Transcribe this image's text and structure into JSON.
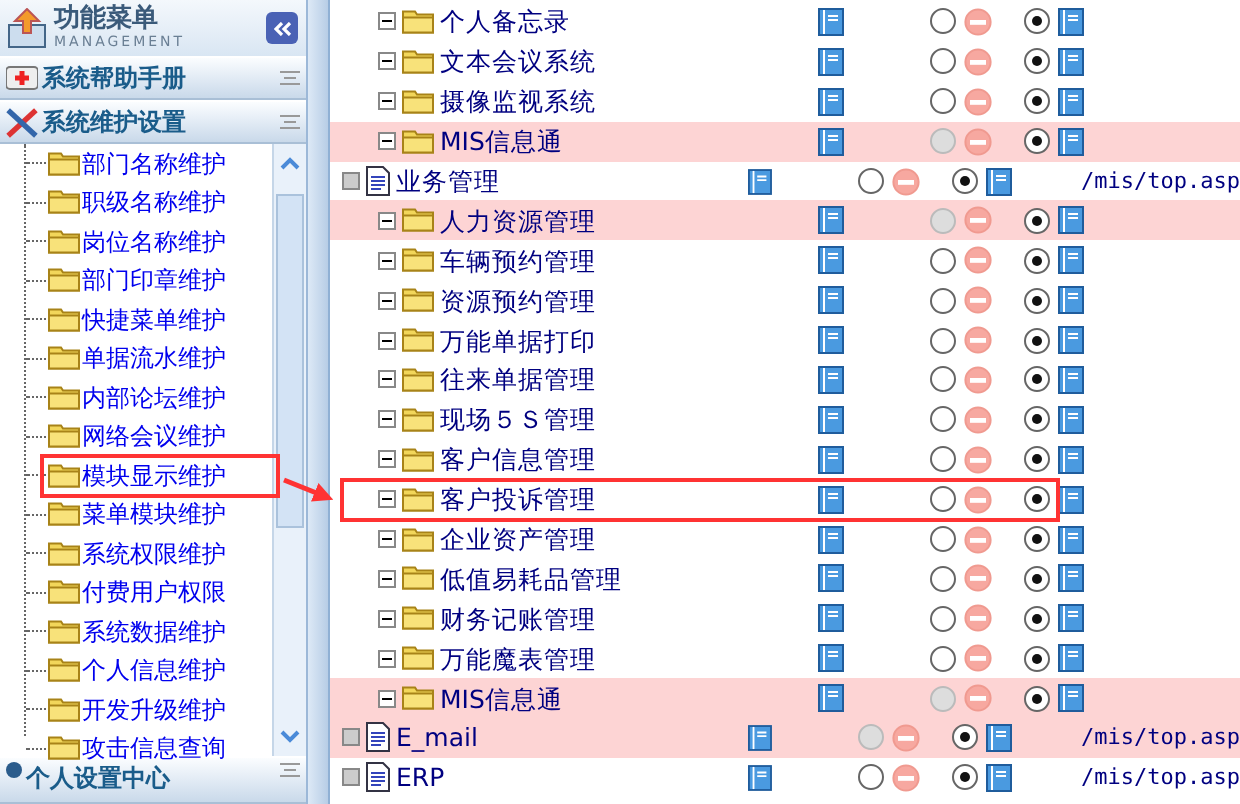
{
  "sidebar": {
    "title": "功能菜单",
    "subtitle": "MANAGEMENT",
    "sections": [
      {
        "label": "系统帮助手册",
        "kind": "help"
      },
      {
        "label": "系统维护设置",
        "kind": "tools"
      }
    ],
    "items": [
      "部门名称维护",
      "职级名称维护",
      "岗位名称维护",
      "部门印章维护",
      "快捷菜单维护",
      "单据流水维护",
      "内部论坛维护",
      "网络会议维护",
      "模块显示维护",
      "菜单模块维护",
      "系统权限维护",
      "付费用户权限",
      "系统数据维护",
      "个人信息维护",
      "开发升级维护",
      "攻击信息查询"
    ],
    "footer_section": {
      "label": "个人设置中心"
    }
  },
  "rows": [
    {
      "label": "个人备忘录",
      "kind": "folder",
      "highlighted": false,
      "disabled": false,
      "shown": true
    },
    {
      "label": "文本会议系统",
      "kind": "folder",
      "highlighted": false,
      "disabled": false,
      "shown": true
    },
    {
      "label": "摄像监视系统",
      "kind": "folder",
      "highlighted": false,
      "disabled": false,
      "shown": true
    },
    {
      "label": "MIS信息通",
      "kind": "folder",
      "highlighted": true,
      "disabled": true,
      "shown": true
    },
    {
      "label": "业务管理",
      "kind": "page",
      "highlighted": false,
      "disabled": false,
      "shown": true,
      "url": "/mis/top.asp"
    },
    {
      "label": "人力资源管理",
      "kind": "folder",
      "highlighted": true,
      "disabled": true,
      "shown": true
    },
    {
      "label": "车辆预约管理",
      "kind": "folder",
      "highlighted": false,
      "disabled": false,
      "shown": true
    },
    {
      "label": "资源预约管理",
      "kind": "folder",
      "highlighted": false,
      "disabled": false,
      "shown": true
    },
    {
      "label": "万能单据打印",
      "kind": "folder",
      "highlighted": false,
      "disabled": false,
      "shown": true
    },
    {
      "label": "往来单据管理",
      "kind": "folder",
      "highlighted": false,
      "disabled": false,
      "shown": true
    },
    {
      "label": "现场５Ｓ管理",
      "kind": "folder",
      "highlighted": false,
      "disabled": false,
      "shown": true
    },
    {
      "label": "客户信息管理",
      "kind": "folder",
      "highlighted": false,
      "disabled": false,
      "shown": true
    },
    {
      "label": "客户投诉管理",
      "kind": "folder",
      "highlighted": false,
      "disabled": false,
      "shown": true
    },
    {
      "label": "企业资产管理",
      "kind": "folder",
      "highlighted": false,
      "disabled": false,
      "shown": true
    },
    {
      "label": "低值易耗品管理",
      "kind": "folder",
      "highlighted": false,
      "disabled": false,
      "shown": true
    },
    {
      "label": "财务记账管理",
      "kind": "folder",
      "highlighted": false,
      "disabled": false,
      "shown": true
    },
    {
      "label": "万能魔表管理",
      "kind": "folder",
      "highlighted": false,
      "disabled": false,
      "shown": true
    },
    {
      "label": "MIS信息通",
      "kind": "folder",
      "highlighted": true,
      "disabled": true,
      "shown": true
    },
    {
      "label": "E_mail",
      "kind": "page",
      "highlighted": true,
      "disabled": true,
      "shown": true,
      "url": "/mis/top.asp"
    },
    {
      "label": "ERP",
      "kind": "page",
      "highlighted": false,
      "disabled": false,
      "shown": true,
      "url": "/mis/top.asp"
    }
  ]
}
